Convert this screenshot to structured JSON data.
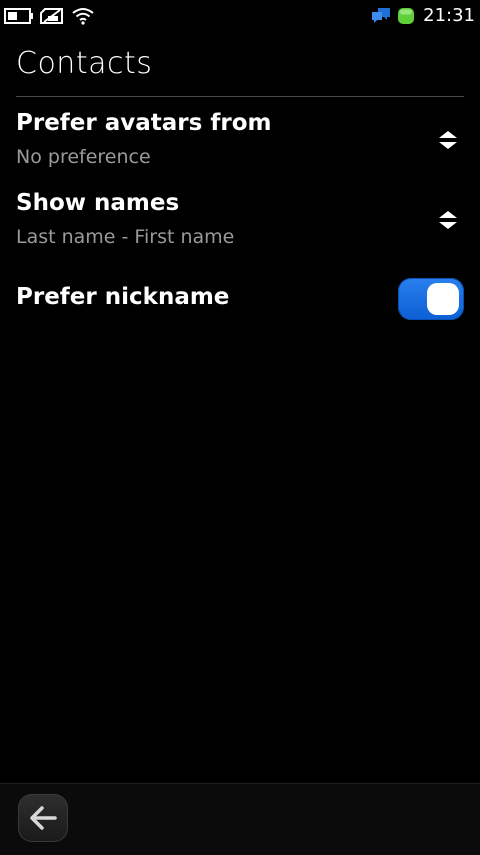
{
  "status_bar": {
    "time": "21:31",
    "icons": [
      "battery-icon",
      "sim-icon",
      "wifi-icon",
      "chat-icon",
      "presence-online-icon"
    ]
  },
  "header": {
    "title": "Contacts"
  },
  "settings": [
    {
      "title": "Prefer avatars from",
      "value": "No preference",
      "control": "picker-icon"
    },
    {
      "title": "Show names",
      "value": "Last name - First name",
      "control": "picker-icon"
    },
    {
      "title": "Prefer nickname",
      "control": "toggle",
      "toggle_on": true
    }
  ],
  "toolbar": {
    "back_icon": "back-arrow-icon"
  },
  "colors": {
    "background": "#000000",
    "accent": "#1a6fe0",
    "secondary_text": "#9a9a9a",
    "presence_online": "#5fcf3a",
    "chat_icon": "#1e6fd8"
  }
}
